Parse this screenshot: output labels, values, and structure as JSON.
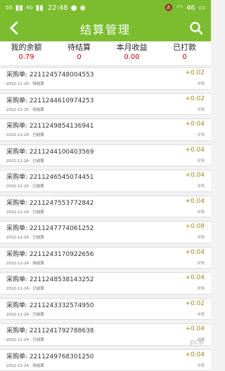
{
  "status_bar": {
    "signal1": "5G",
    "signal2": "4G",
    "time": "22:48",
    "battery": "46"
  },
  "header": {
    "title": "结算管理",
    "back_icon": "back-chevron-icon",
    "search_icon": "search-icon"
  },
  "summary": [
    {
      "label": "我的余额",
      "value": "0.79"
    },
    {
      "label": "待结算",
      "value": "0"
    },
    {
      "label": "本月收益",
      "value": "0.00"
    },
    {
      "label": "已打款",
      "value": "0"
    }
  ],
  "records": [
    {
      "title": "采购单: 2211245748004553",
      "amount": "+0.02",
      "meta": "2022-11-25 · 待结算",
      "link": "详情"
    },
    {
      "title": "采购单: 2211244610974253",
      "amount": "+0.02",
      "meta": "2022-11-25 · 待结算",
      "link": "详情"
    },
    {
      "title": "采购单: 2211249854136941",
      "amount": "+0.04",
      "meta": "2022-11-24 · 已结算",
      "link": "详情"
    },
    {
      "title": "采购单: 2211244100403569",
      "amount": "+0.04",
      "meta": "2022-11-24 · 已结算",
      "link": "详情"
    },
    {
      "title": "采购单: 2211246545074451",
      "amount": "+0.04",
      "meta": "2022-11-24 · 已结算",
      "link": "详情"
    },
    {
      "title": "采购单: 2211247553772842",
      "amount": "+0.04",
      "meta": "2022-11-24 · 已结算",
      "link": "详情"
    },
    {
      "title": "采购单: 2211247774061252",
      "amount": "+0.08",
      "meta": "2022-11-24 · 已结算",
      "link": "详情"
    },
    {
      "title": "采购单: 2211243170922656",
      "amount": "+0.04",
      "meta": "2022-11-24 · 待结算",
      "link": "详情"
    },
    {
      "title": "采购单: 2211248538143252",
      "amount": "+0.04",
      "meta": "2022-11-24 · 已结算",
      "link": "详情"
    },
    {
      "title": "采购单: 2211243332574950",
      "amount": "+0.02",
      "meta": "2022-11-24 · 已结算",
      "link": "详情"
    },
    {
      "title": "采购单: 2211241792788638",
      "amount": "+0.04",
      "meta": "2022-11-24 · 已结算",
      "link": "详情"
    },
    {
      "title": "采购单: 2211249768301250",
      "amount": "+0.04",
      "meta": "2022-11-24 · 待结算",
      "link": "详情"
    }
  ],
  "watermark": "pc6"
}
